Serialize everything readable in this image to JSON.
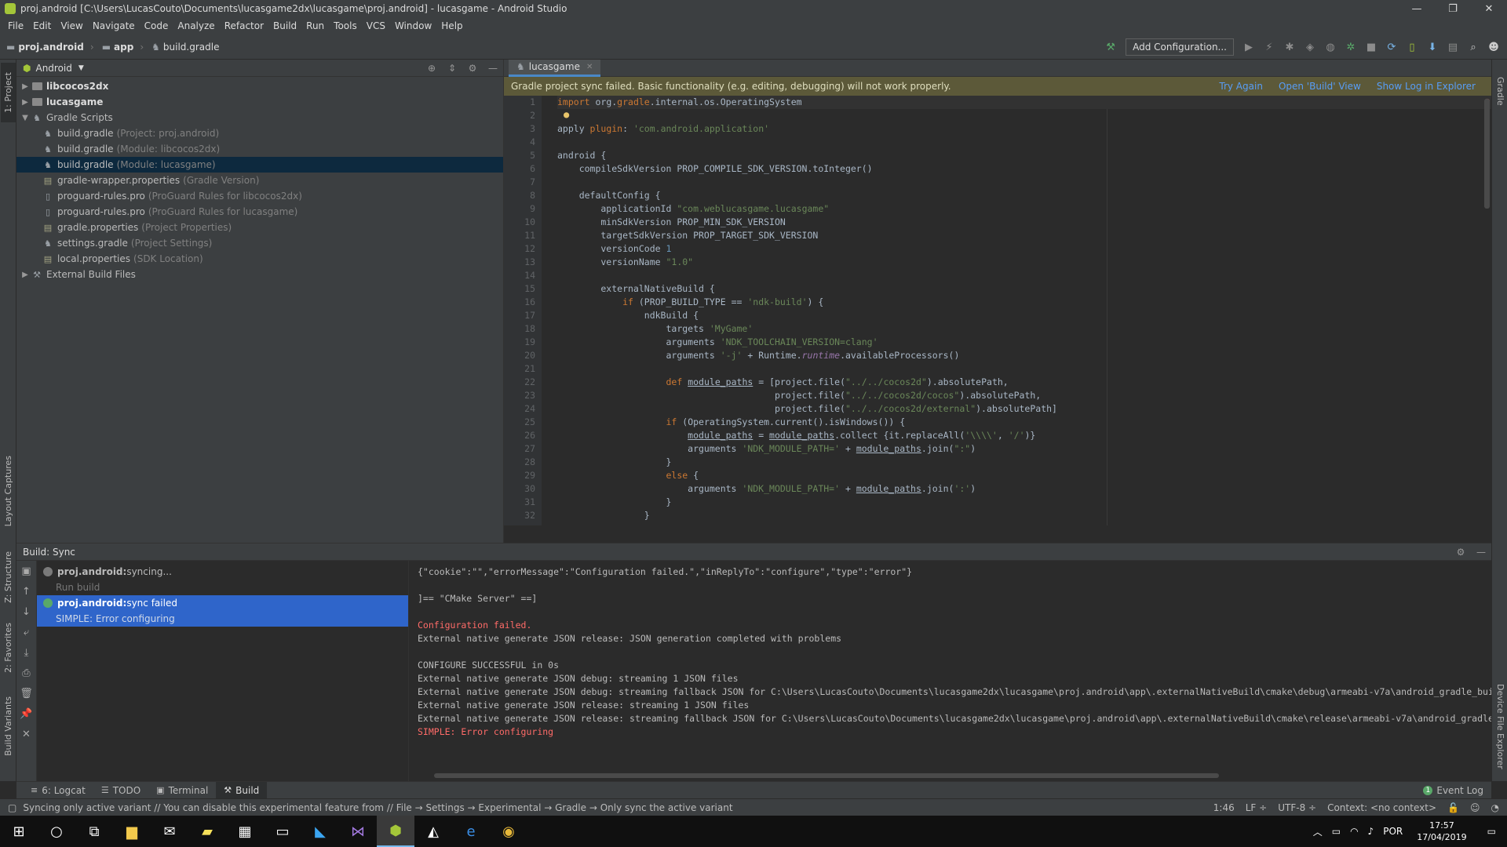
{
  "window": {
    "title": "proj.android [C:\\Users\\LucasCouto\\Documents\\lucasgame2dx\\lucasgame\\proj.android] - lucasgame - Android Studio"
  },
  "menu": [
    "File",
    "Edit",
    "View",
    "Navigate",
    "Code",
    "Analyze",
    "Refactor",
    "Build",
    "Run",
    "Tools",
    "VCS",
    "Window",
    "Help"
  ],
  "breadcrumbs": [
    "proj.android",
    "app",
    "build.gradle"
  ],
  "toolbar": {
    "add_configuration": "Add Configuration..."
  },
  "left_tabs": {
    "project": "1: Project",
    "layout_captures": "Layout Captures",
    "structure": "Z: Structure",
    "favorites": "2: Favorites",
    "build_variants": "Build Variants"
  },
  "right_tabs": {
    "gradle": "Gradle",
    "device_file_explorer": "Device File Explorer"
  },
  "project": {
    "view": "Android",
    "tree": [
      {
        "label": "libcocos2dx",
        "hint": "",
        "level": 0,
        "expand": "▶",
        "type": "folder",
        "bold": true,
        "selected": false
      },
      {
        "label": "lucasgame",
        "hint": "",
        "level": 0,
        "expand": "▶",
        "type": "folder",
        "bold": true,
        "selected": false
      },
      {
        "label": "Gradle Scripts",
        "hint": "",
        "level": 0,
        "expand": "▼",
        "type": "gradle",
        "bold": false,
        "selected": false
      },
      {
        "label": "build.gradle",
        "hint": "(Project: proj.android)",
        "level": 1,
        "expand": "",
        "type": "gradle",
        "bold": false,
        "selected": false
      },
      {
        "label": "build.gradle",
        "hint": "(Module: libcocos2dx)",
        "level": 1,
        "expand": "",
        "type": "gradle",
        "bold": false,
        "selected": false
      },
      {
        "label": "build.gradle",
        "hint": "(Module: lucasgame)",
        "level": 1,
        "expand": "",
        "type": "gradle",
        "bold": false,
        "selected": true
      },
      {
        "label": "gradle-wrapper.properties",
        "hint": "(Gradle Version)",
        "level": 1,
        "expand": "",
        "type": "props",
        "bold": false,
        "selected": false
      },
      {
        "label": "proguard-rules.pro",
        "hint": "(ProGuard Rules for libcocos2dx)",
        "level": 1,
        "expand": "",
        "type": "file",
        "bold": false,
        "selected": false
      },
      {
        "label": "proguard-rules.pro",
        "hint": "(ProGuard Rules for lucasgame)",
        "level": 1,
        "expand": "",
        "type": "file",
        "bold": false,
        "selected": false
      },
      {
        "label": "gradle.properties",
        "hint": "(Project Properties)",
        "level": 1,
        "expand": "",
        "type": "props",
        "bold": false,
        "selected": false
      },
      {
        "label": "settings.gradle",
        "hint": "(Project Settings)",
        "level": 1,
        "expand": "",
        "type": "gradle",
        "bold": false,
        "selected": false
      },
      {
        "label": "local.properties",
        "hint": "(SDK Location)",
        "level": 1,
        "expand": "",
        "type": "props",
        "bold": false,
        "selected": false
      },
      {
        "label": "External Build Files",
        "hint": "",
        "level": 0,
        "expand": "▶",
        "type": "ext",
        "bold": false,
        "selected": false
      }
    ]
  },
  "editor": {
    "tab": "lucasgame",
    "banner": {
      "message": "Gradle project sync failed. Basic functionality (e.g. editing, debugging) will not work properly.",
      "try_again": "Try Again",
      "open_build": "Open 'Build' View",
      "show_log": "Show Log in Explorer"
    },
    "line_numbers": [
      "1",
      "2",
      "3",
      "4",
      "5",
      "6",
      "7",
      "8",
      "9",
      "10",
      "11",
      "12",
      "13",
      "14",
      "15",
      "16",
      "17",
      "18",
      "19",
      "20",
      "21",
      "22",
      "23",
      "24",
      "25",
      "26",
      "27",
      "28",
      "29",
      "30",
      "31",
      "32"
    ],
    "lines": [
      "<span class=\"k\">import</span> org.<span class=\"k\">gradle</span>.internal.os.OperatingSystem",
      "",
      "apply <span class=\"k\">plugin</span>: <span class=\"s\">'com.android.application'</span>",
      "",
      "android {",
      "    compileSdkVersion PROP_COMPILE_SDK_VERSION.toInteger()",
      "",
      "    defaultConfig {",
      "        applicationId <span class=\"s\">\"com.weblucasgame.lucasgame\"</span>",
      "        minSdkVersion PROP_MIN_SDK_VERSION",
      "        targetSdkVersion PROP_TARGET_SDK_VERSION",
      "        versionCode <span class=\"n\">1</span>",
      "        versionName <span class=\"s\">\"1.0\"</span>",
      "",
      "        externalNativeBuild {",
      "            <span class=\"k\">if</span> (PROP_BUILD_TYPE == <span class=\"s\">'ndk-build'</span>) {",
      "                ndkBuild {",
      "                    targets <span class=\"s\">'MyGame'</span>",
      "                    arguments <span class=\"s\">'NDK_TOOLCHAIN_VERSION=clang'</span>",
      "                    arguments <span class=\"s\">'-j'</span> + Runtime.<span class=\"i\">runtime</span>.availableProcessors()",
      "",
      "                    <span class=\"k\">def</span> <span class=\"u\">module_paths</span> = [project.file(<span class=\"s\">\"../../cocos2d\"</span>).absolutePath,",
      "                                        project.file(<span class=\"s\">\"../../cocos2d/cocos\"</span>).absolutePath,",
      "                                        project.file(<span class=\"s\">\"../../cocos2d/external\"</span>).absolutePath]",
      "                    <span class=\"k\">if</span> (OperatingSystem.current().isWindows()) {",
      "                        <span class=\"u\">module_paths</span> = <span class=\"u\">module_paths</span>.collect {it.replaceAll(<span class=\"s\">'\\\\\\\\'</span>, <span class=\"s\">'/'</span>)}",
      "                        arguments <span class=\"s\">'NDK_MODULE_PATH='</span> + <span class=\"u\">module_paths</span>.join(<span class=\"s\">\":\"</span>)",
      "                    }",
      "                    <span class=\"k\">else</span> {",
      "                        arguments <span class=\"s\">'NDK_MODULE_PATH='</span> + <span class=\"u\">module_paths</span>.join(<span class=\"s\">':'</span>)",
      "                    }",
      "                }"
    ]
  },
  "build": {
    "title": "Build: Sync",
    "tree": [
      {
        "bold": "proj.android:",
        "text": " syncing...",
        "sub": false,
        "selected": false,
        "icon": "#7a7a7a"
      },
      {
        "bold": "",
        "text": "Run build",
        "sub": true,
        "selected": false,
        "icon": ""
      },
      {
        "bold": "proj.android:",
        "text": " sync failed",
        "sub": false,
        "selected": true,
        "icon": "#59a869"
      },
      {
        "bold": "",
        "text": "SIMPLE: Error configuring",
        "sub": true,
        "selected": true,
        "icon": ""
      }
    ],
    "log": [
      {
        "text": "{\"cookie\":\"\",\"errorMessage\":\"Configuration failed.\",\"inReplyTo\":\"configure\",\"type\":\"error\"}",
        "error": false
      },
      {
        "text": "",
        "error": false
      },
      {
        "text": "]== \"CMake Server\" ==]",
        "error": false
      },
      {
        "text": "",
        "error": false
      },
      {
        "text": "Configuration failed.",
        "error": true
      },
      {
        "text": "External native generate JSON release: JSON generation completed with problems",
        "error": false
      },
      {
        "text": "",
        "error": false
      },
      {
        "text": "CONFIGURE SUCCESSFUL in 0s",
        "error": false
      },
      {
        "text": "External native generate JSON debug: streaming 1 JSON files",
        "error": false
      },
      {
        "text": "External native generate JSON debug: streaming fallback JSON for C:\\Users\\LucasCouto\\Documents\\lucasgame2dx\\lucasgame\\proj.android\\app\\.externalNativeBuild\\cmake\\debug\\armeabi-v7a\\android_gradle_build.json",
        "error": false
      },
      {
        "text": "External native generate JSON release: streaming 1 JSON files",
        "error": false
      },
      {
        "text": "External native generate JSON release: streaming fallback JSON for C:\\Users\\LucasCouto\\Documents\\lucasgame2dx\\lucasgame\\proj.android\\app\\.externalNativeBuild\\cmake\\release\\armeabi-v7a\\android_gradle_build.json",
        "error": false
      },
      {
        "text": "SIMPLE: Error configuring",
        "error": true
      }
    ]
  },
  "bottom_tabs": [
    {
      "label": "6: Logcat",
      "icon": "≡",
      "active": false
    },
    {
      "label": "TODO",
      "icon": "☰",
      "active": false
    },
    {
      "label": "Terminal",
      "icon": "▣",
      "active": false
    },
    {
      "label": "Build",
      "icon": "⚒",
      "active": true
    }
  ],
  "event_log": {
    "label": "Event Log",
    "count": "1"
  },
  "status": {
    "message": "Syncing only active variant // You can disable this experimental feature from // File → Settings → Experimental → Gradle → Only sync the active variant",
    "position": "1:46",
    "line_sep": "LF ÷",
    "encoding": "UTF-8 ÷",
    "context": "Context: <no context>"
  },
  "taskbar": {
    "lang": "POR",
    "time": "17:57",
    "date": "17/04/2019"
  }
}
